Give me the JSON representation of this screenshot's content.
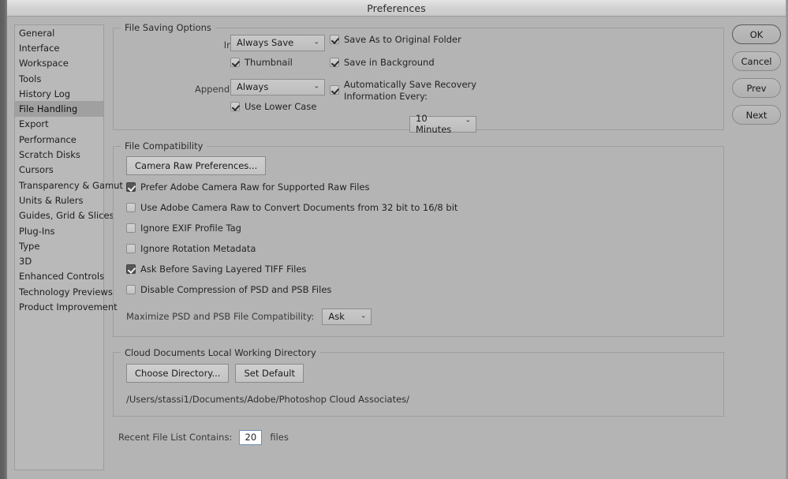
{
  "window": {
    "title": "Preferences"
  },
  "sidebar": {
    "items": [
      {
        "label": "General",
        "selected": false
      },
      {
        "label": "Interface",
        "selected": false
      },
      {
        "label": "Workspace",
        "selected": false
      },
      {
        "label": "Tools",
        "selected": false
      },
      {
        "label": "History Log",
        "selected": false
      },
      {
        "label": "File Handling",
        "selected": true
      },
      {
        "label": "Export",
        "selected": false
      },
      {
        "label": "Performance",
        "selected": false
      },
      {
        "label": "Scratch Disks",
        "selected": false
      },
      {
        "label": "Cursors",
        "selected": false
      },
      {
        "label": "Transparency & Gamut",
        "selected": false
      },
      {
        "label": "Units & Rulers",
        "selected": false
      },
      {
        "label": "Guides, Grid & Slices",
        "selected": false
      },
      {
        "label": "Plug-Ins",
        "selected": false
      },
      {
        "label": "Type",
        "selected": false
      },
      {
        "label": "3D",
        "selected": false
      },
      {
        "label": "Enhanced Controls",
        "selected": false
      },
      {
        "label": "Technology Previews",
        "selected": false
      },
      {
        "label": "Product Improvement",
        "selected": false
      }
    ]
  },
  "actions": {
    "ok": "OK",
    "cancel": "Cancel",
    "prev": "Prev",
    "next": "Next"
  },
  "file_saving": {
    "legend": "File Saving Options",
    "image_previews_label": "Image Previews:",
    "image_previews_value": "Always Save",
    "thumbnail_label": "Thumbnail",
    "append_ext_label": "Append File Extension:",
    "append_ext_value": "Always",
    "use_lower_case_label": "Use Lower Case",
    "save_as_original_label": "Save As to Original Folder",
    "save_background_label": "Save in Background",
    "auto_recovery_label": "Automatically Save Recovery Information Every:",
    "recovery_interval_value": "10 Minutes"
  },
  "file_compatibility": {
    "legend": "File Compatibility",
    "camera_raw_button": "Camera Raw Preferences...",
    "checkboxes": [
      {
        "label": "Prefer Adobe Camera Raw for Supported Raw Files",
        "checked": true,
        "style": "dark"
      },
      {
        "label": "Use Adobe Camera Raw to Convert Documents from 32 bit to 16/8 bit",
        "checked": false,
        "style": "light"
      },
      {
        "label": "Ignore EXIF Profile Tag",
        "checked": false,
        "style": "light"
      },
      {
        "label": "Ignore Rotation Metadata",
        "checked": false,
        "style": "light"
      },
      {
        "label": "Ask Before Saving Layered TIFF Files",
        "checked": true,
        "style": "dark"
      },
      {
        "label": "Disable Compression of PSD and PSB Files",
        "checked": false,
        "style": "light"
      }
    ],
    "maximize_label": "Maximize PSD and PSB File Compatibility:",
    "maximize_value": "Ask"
  },
  "cloud_documents": {
    "legend": "Cloud Documents Local Working Directory",
    "choose_directory_button": "Choose Directory...",
    "set_default_button": "Set Default",
    "path": "/Users/stassi1/Documents/Adobe/Photoshop Cloud Associates/"
  },
  "recent_files": {
    "label": "Recent File List Contains:",
    "value": "20",
    "suffix": "files"
  },
  "icons": {
    "chevron_down": "⌄",
    "checkmark": "✓"
  }
}
